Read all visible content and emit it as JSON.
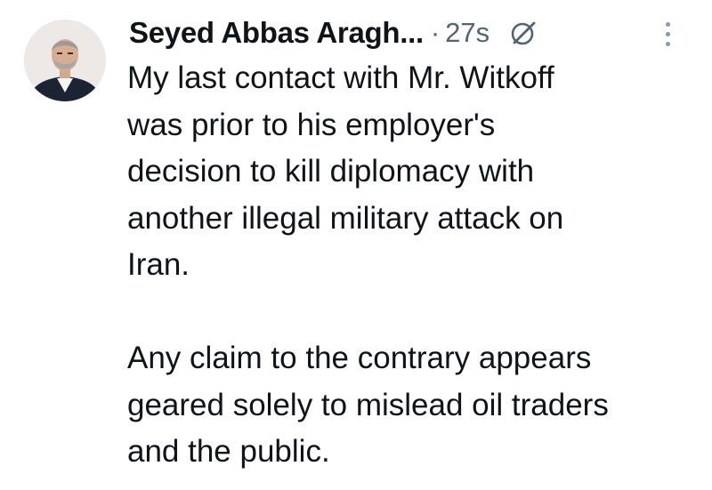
{
  "tweet": {
    "author": {
      "display_name": "Seyed Abbas Aragh...",
      "avatar_icon": "author-avatar"
    },
    "separator": "·",
    "timestamp": "27s",
    "grok_icon": "grok-icon",
    "more_icon": "more-options-icon",
    "paragraphs": [
      {
        "lines": [
          "My last contact with Mr. Witkoff",
          "was prior to his employer's",
          "decision to kill diplomacy with",
          "another illegal military attack on",
          "Iran."
        ]
      },
      {
        "lines": [
          "Any claim to the contrary appears",
          "geared solely to mislead oil traders",
          "and the public."
        ]
      }
    ]
  },
  "colors": {
    "text": "#0f1419",
    "secondary": "#536471",
    "background": "#ffffff"
  }
}
